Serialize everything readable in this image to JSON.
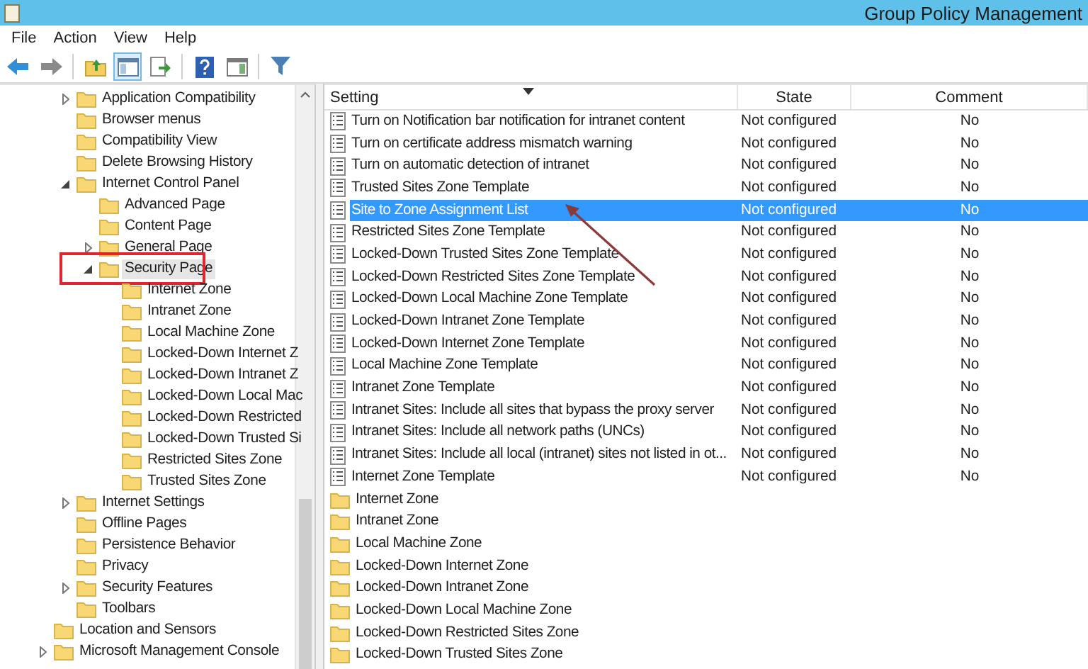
{
  "window": {
    "title": "Group Policy Management"
  },
  "menu": [
    "File",
    "Action",
    "View",
    "Help"
  ],
  "toolbar": [
    {
      "kind": "back"
    },
    {
      "kind": "forward"
    },
    {
      "kind": "separator"
    },
    {
      "kind": "up"
    },
    {
      "kind": "tree",
      "selected": true
    },
    {
      "kind": "export"
    },
    {
      "kind": "separator"
    },
    {
      "kind": "help"
    },
    {
      "kind": "pane",
      "selected": false
    },
    {
      "kind": "separator"
    },
    {
      "kind": "filter"
    }
  ],
  "tree": [
    {
      "label": "Application Compatibility",
      "expanded": false,
      "selected": false,
      "boxed": false
    },
    {
      "label": "Browser menus",
      "selected": false,
      "boxed": false
    },
    {
      "label": "Compatibility View",
      "selected": false,
      "boxed": false
    },
    {
      "label": "Delete Browsing History",
      "selected": false,
      "boxed": false
    },
    {
      "label": "Internet Control Panel",
      "expanded": true,
      "selected": false,
      "boxed": false,
      "children": [
        {
          "label": "Advanced Page",
          "selected": false,
          "boxed": false
        },
        {
          "label": "Content Page",
          "selected": false,
          "boxed": false
        },
        {
          "label": "General Page",
          "expanded": false,
          "selected": false,
          "boxed": false
        },
        {
          "label": "Security Page",
          "expanded": true,
          "selected": true,
          "boxed": true,
          "children": [
            {
              "label": "Internet Zone",
              "selected": false,
              "boxed": false
            },
            {
              "label": "Intranet Zone",
              "selected": false,
              "boxed": false
            },
            {
              "label": "Local Machine Zone",
              "selected": false,
              "boxed": false
            },
            {
              "label": "Locked-Down Internet Z",
              "selected": false,
              "boxed": false
            },
            {
              "label": "Locked-Down Intranet Z",
              "selected": false,
              "boxed": false
            },
            {
              "label": "Locked-Down Local Mac",
              "selected": false,
              "boxed": false
            },
            {
              "label": "Locked-Down Restricted",
              "selected": false,
              "boxed": false
            },
            {
              "label": "Locked-Down Trusted Si",
              "selected": false,
              "boxed": false
            },
            {
              "label": "Restricted Sites Zone",
              "selected": false,
              "boxed": false
            },
            {
              "label": "Trusted Sites Zone",
              "selected": false,
              "boxed": false
            }
          ]
        }
      ]
    },
    {
      "label": "Internet Settings",
      "expanded": false,
      "selected": false,
      "boxed": false
    },
    {
      "label": "Offline Pages",
      "selected": false,
      "boxed": false
    },
    {
      "label": "Persistence Behavior",
      "selected": false,
      "boxed": false
    },
    {
      "label": "Privacy",
      "selected": false,
      "boxed": false
    },
    {
      "label": "Security Features",
      "expanded": false,
      "selected": false,
      "boxed": false
    },
    {
      "label": "Toolbars",
      "selected": false,
      "boxed": false
    }
  ],
  "tree_outer": [
    {
      "label": "Location and Sensors",
      "selected": false,
      "boxed": false
    },
    {
      "label": "Microsoft Management Console",
      "expanded": false,
      "selected": false,
      "boxed": false
    }
  ],
  "table": {
    "columns": [
      "Setting",
      "State",
      "Comment"
    ],
    "rows": [
      {
        "kind": "setting",
        "setting": "Turn on Notification bar notification for intranet content",
        "state": "Not configured",
        "comment": "No",
        "selected": false,
        "annotated": false
      },
      {
        "kind": "setting",
        "setting": "Turn on certificate address mismatch warning",
        "state": "Not configured",
        "comment": "No",
        "selected": false,
        "annotated": false
      },
      {
        "kind": "setting",
        "setting": "Turn on automatic detection of intranet",
        "state": "Not configured",
        "comment": "No",
        "selected": false,
        "annotated": false
      },
      {
        "kind": "setting",
        "setting": "Trusted Sites Zone Template",
        "state": "Not configured",
        "comment": "No",
        "selected": false,
        "annotated": false
      },
      {
        "kind": "setting",
        "setting": "Site to Zone Assignment List",
        "state": "Not configured",
        "comment": "No",
        "selected": true,
        "annotated": true
      },
      {
        "kind": "setting",
        "setting": "Restricted Sites Zone Template",
        "state": "Not configured",
        "comment": "No",
        "selected": false,
        "annotated": false
      },
      {
        "kind": "setting",
        "setting": "Locked-Down Trusted Sites Zone Template",
        "state": "Not configured",
        "comment": "No",
        "selected": false,
        "annotated": false
      },
      {
        "kind": "setting",
        "setting": "Locked-Down Restricted Sites Zone Template",
        "state": "Not configured",
        "comment": "No",
        "selected": false,
        "annotated": false
      },
      {
        "kind": "setting",
        "setting": "Locked-Down Local Machine Zone Template",
        "state": "Not configured",
        "comment": "No",
        "selected": false,
        "annotated": false
      },
      {
        "kind": "setting",
        "setting": "Locked-Down Intranet Zone Template",
        "state": "Not configured",
        "comment": "No",
        "selected": false,
        "annotated": false
      },
      {
        "kind": "setting",
        "setting": "Locked-Down Internet Zone Template",
        "state": "Not configured",
        "comment": "No",
        "selected": false,
        "annotated": false
      },
      {
        "kind": "setting",
        "setting": "Local Machine Zone Template",
        "state": "Not configured",
        "comment": "No",
        "selected": false,
        "annotated": false
      },
      {
        "kind": "setting",
        "setting": "Intranet Zone Template",
        "state": "Not configured",
        "comment": "No",
        "selected": false,
        "annotated": false
      },
      {
        "kind": "setting",
        "setting": "Intranet Sites: Include all sites that bypass the proxy server",
        "state": "Not configured",
        "comment": "No",
        "selected": false,
        "annotated": false
      },
      {
        "kind": "setting",
        "setting": "Intranet Sites: Include all network paths (UNCs)",
        "state": "Not configured",
        "comment": "No",
        "selected": false,
        "annotated": false
      },
      {
        "kind": "setting",
        "setting": "Intranet Sites: Include all local (intranet) sites not listed in ot...",
        "state": "Not configured",
        "comment": "No",
        "selected": false,
        "annotated": false
      },
      {
        "kind": "setting",
        "setting": "Internet Zone Template",
        "state": "Not configured",
        "comment": "No",
        "selected": false,
        "annotated": false
      },
      {
        "kind": "folder",
        "setting": "Internet Zone",
        "selected": false,
        "annotated": false
      },
      {
        "kind": "folder",
        "setting": "Intranet Zone",
        "selected": false,
        "annotated": false
      },
      {
        "kind": "folder",
        "setting": "Local Machine Zone",
        "selected": false,
        "annotated": false
      },
      {
        "kind": "folder",
        "setting": "Locked-Down Internet Zone",
        "selected": false,
        "annotated": false
      },
      {
        "kind": "folder",
        "setting": "Locked-Down Intranet Zone",
        "selected": false,
        "annotated": false
      },
      {
        "kind": "folder",
        "setting": "Locked-Down Local Machine Zone",
        "selected": false,
        "annotated": false
      },
      {
        "kind": "folder",
        "setting": "Locked-Down Restricted Sites Zone",
        "selected": false,
        "annotated": false
      },
      {
        "kind": "folder",
        "setting": "Locked-Down Trusted Sites Zone",
        "selected": false,
        "annotated": false
      }
    ]
  }
}
